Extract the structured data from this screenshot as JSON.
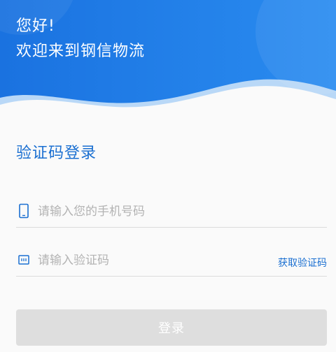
{
  "header": {
    "greeting": "您好!",
    "welcome": "欢迎来到钢信物流"
  },
  "login": {
    "title": "验证码登录",
    "phone_placeholder": "请输入您的手机号码",
    "phone_value": "",
    "code_placeholder": "请输入验证码",
    "code_value": "",
    "get_code_label": "获取验证码",
    "submit_label": "登录"
  },
  "icons": {
    "phone": "phone-icon",
    "code": "sms-code-icon"
  },
  "colors": {
    "header_blue": "#1f7ee6",
    "accent": "#1a6fd1",
    "button_disabled": "#dedede"
  }
}
